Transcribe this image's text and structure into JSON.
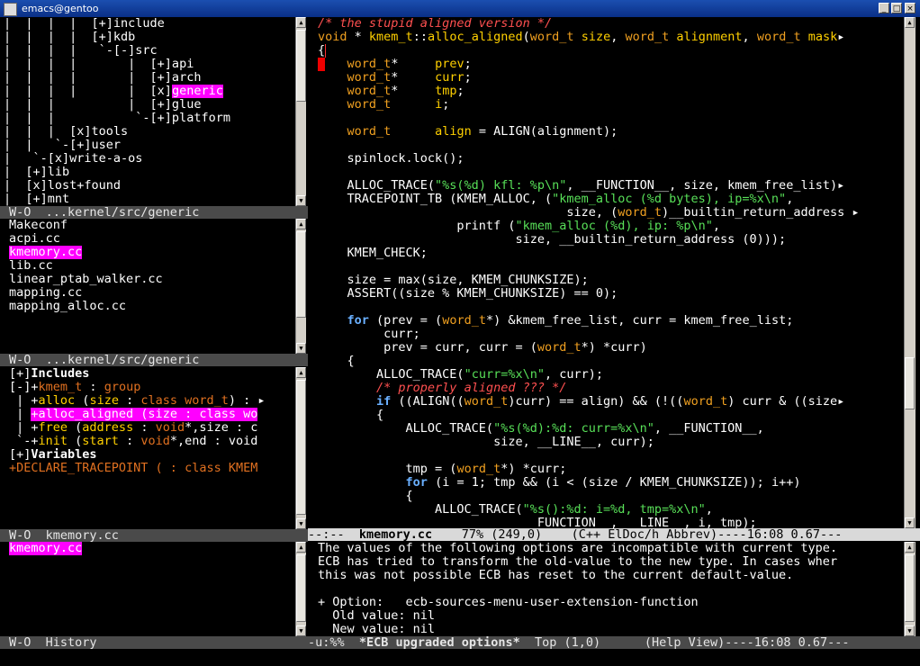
{
  "window": {
    "title": "emacs@gentoo",
    "minimize": "_",
    "maximize": "□",
    "close": "×"
  },
  "tree": {
    "lines": [
      "|  |  |  |  [+]include",
      "|  |  |  |  [+]kdb",
      "|  |  |  |   `-[-]src",
      "|  |  |  |       |  [+]api",
      "|  |  |  |       |  [+]arch",
      "|  |  |  |       |  [x]",
      "|  |  |          |  [+]glue",
      "|  |  |           `-[+]platform",
      "|  |  |  [x]tools",
      "|  |   `-[+]user",
      "|   `-[x]write-a-os",
      "|  [+]lib",
      "|  [x]lost+found",
      "|  [+]mnt"
    ],
    "highlight": "generic",
    "modeline": "W-O  ...kernel/src/generic"
  },
  "files": {
    "items": [
      "Makeconf",
      "acpi.cc",
      "kmemory.cc",
      "lib.cc",
      "linear_ptab_walker.cc",
      "mapping.cc",
      "mapping_alloc.cc"
    ],
    "selected": "kmemory.cc",
    "modeline": "W-O  ...kernel/src/generic"
  },
  "methods": {
    "includes": "Includes",
    "includes_prefix": "[+]",
    "kmem_prefix": "[-]+",
    "kmem_name": "kmem_t",
    "kmem_sep": " : ",
    "kmem_group": "group",
    "items": [
      {
        "indent": " | +",
        "name": "alloc ",
        "open": "(",
        "p1": "size",
        "sep1": " : ",
        "t1": "class word_t",
        "rest": ") : ▸"
      },
      {
        "indent": " | ",
        "name": "+alloc_aligned (size : class wo",
        "highlight": true
      },
      {
        "indent": " | +",
        "name": "free ",
        "open": "(",
        "p1": "address",
        "sep1": " : ",
        "t1": "void",
        "rest": "*,size : c"
      },
      {
        "indent": " `-+",
        "name": "init ",
        "open": "(",
        "p1": "start",
        "sep1": " : ",
        "t1": "void",
        "rest": "*,end : void"
      }
    ],
    "variables": "Variables",
    "variables_prefix": "[+]",
    "declare": "+DECLARE_TRACEPOINT ( : class KMEM",
    "modeline": "W-O  kmemory.cc"
  },
  "history": {
    "items": [
      "kmemory.cc"
    ],
    "modeline": "W-O  History"
  },
  "editor": {
    "modeline": {
      "flags": "--:--  ",
      "buffer": "kmemory.cc",
      "pos": "    77% (249,0)    ",
      "mode": "(C++ ElDoc/h Abbrev)----16:08 0.67---"
    }
  },
  "help": {
    "lines": [
      "The values of the following options are incompatible with current type.",
      "ECB has tried to transform the old-value to the new type. In cases wher",
      "this was not possible ECB has reset to the current default-value.",
      "",
      "+ Option:   ecb-sources-menu-user-extension-function",
      "  Old value: nil",
      "  New value: nil"
    ],
    "modeline": {
      "flags": "-u:%%  ",
      "buffer": "*ECB upgraded options*",
      "pos": "  Top (1,0)      ",
      "mode": "(Help View)----16:08 0.67---"
    }
  }
}
